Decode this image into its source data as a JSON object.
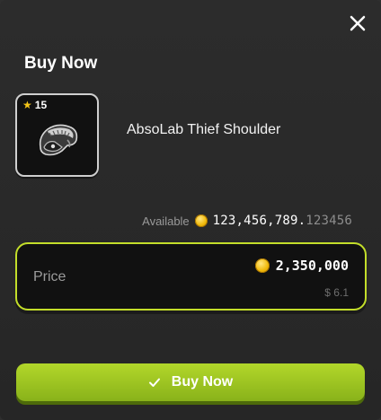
{
  "dialog": {
    "title": "Buy Now",
    "close_icon": "close-icon"
  },
  "item": {
    "badge_icon": "star-icon",
    "badge_value": "15",
    "name": "AbsoLab Thief Shoulder",
    "image_icon": "shoulder-armor-icon"
  },
  "available": {
    "label": "Available",
    "coin_icon": "coin-icon",
    "integer_part": "123,456,789.",
    "decimal_part": "123456"
  },
  "price": {
    "label": "Price",
    "coin_icon": "coin-icon",
    "value": "2,350,000",
    "usd": "$ 6.1"
  },
  "buy_button": {
    "icon": "check-icon",
    "label": "Buy Now"
  },
  "colors": {
    "accent": "#b2d72a",
    "price_border": "#c3de2a",
    "background": "#2c2c2c"
  }
}
